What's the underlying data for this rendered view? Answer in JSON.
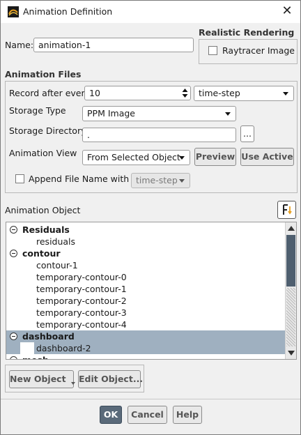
{
  "window": {
    "title": "Animation Definition"
  },
  "name_field": {
    "label": "Name:",
    "value": "animation-1"
  },
  "realistic_rendering": {
    "heading": "Realistic Rendering",
    "raytracer_label": "Raytracer Image"
  },
  "animation_files": {
    "heading": "Animation Files",
    "record_label": "Record after every",
    "record_value": "10",
    "record_unit": "time-step",
    "storage_type_label": "Storage Type",
    "storage_type_value": "PPM Image",
    "storage_dir_label": "Storage Directory",
    "storage_dir_value": ".",
    "browse_label": "...",
    "animation_view_label": "Animation View",
    "animation_view_value": "From Selected Object",
    "preview_label": "Preview",
    "use_active_label": "Use Active",
    "append_label": "Append File Name with",
    "append_value": "time-step"
  },
  "animation_object": {
    "heading": "Animation Object",
    "tree": [
      {
        "label": "Residuals",
        "group": true
      },
      {
        "label": "residuals",
        "group": false
      },
      {
        "label": "contour",
        "group": true
      },
      {
        "label": "contour-1",
        "group": false
      },
      {
        "label": "temporary-contour-0",
        "group": false
      },
      {
        "label": "temporary-contour-1",
        "group": false
      },
      {
        "label": "temporary-contour-2",
        "group": false
      },
      {
        "label": "temporary-contour-3",
        "group": false
      },
      {
        "label": "temporary-contour-4",
        "group": false
      },
      {
        "label": "dashboard",
        "group": true
      },
      {
        "label": "dashboard-2",
        "group": false
      },
      {
        "label": "mesh",
        "group": true
      }
    ],
    "new_object_label": "New Object",
    "edit_object_label": "Edit Object..."
  },
  "footer": {
    "ok_label": "OK",
    "cancel_label": "Cancel",
    "help_label": "Help"
  },
  "colors": {
    "selection": "#9fb0c0",
    "primary_button": "#5a6a7a",
    "scroll_thumb": "#4f5f6f"
  }
}
